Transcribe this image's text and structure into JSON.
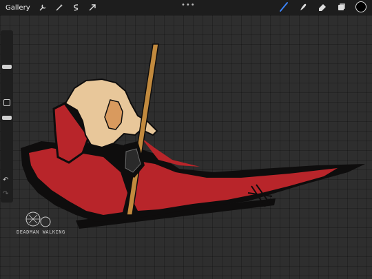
{
  "topbar": {
    "gallery_label": "Gallery",
    "left_tools": [
      "wrench-icon",
      "magic-wand-icon",
      "selection-icon",
      "transform-arrow-icon"
    ],
    "more_label": "•••",
    "right_tools": [
      "brush-icon",
      "smudge-icon",
      "eraser-icon",
      "layers-icon"
    ],
    "active_tool": "brush-icon",
    "active_color": "#000000"
  },
  "sidebar": {
    "undo_icon": "↶",
    "redo_icon": "↷"
  },
  "artwork": {
    "signature_text": "DEADMAN WALKING",
    "colors": {
      "cape": "#b8252a",
      "outline": "#0e0d0d",
      "hair": "#e8c79a",
      "skin": "#d99a5e",
      "staff": "#c28a3e"
    }
  }
}
